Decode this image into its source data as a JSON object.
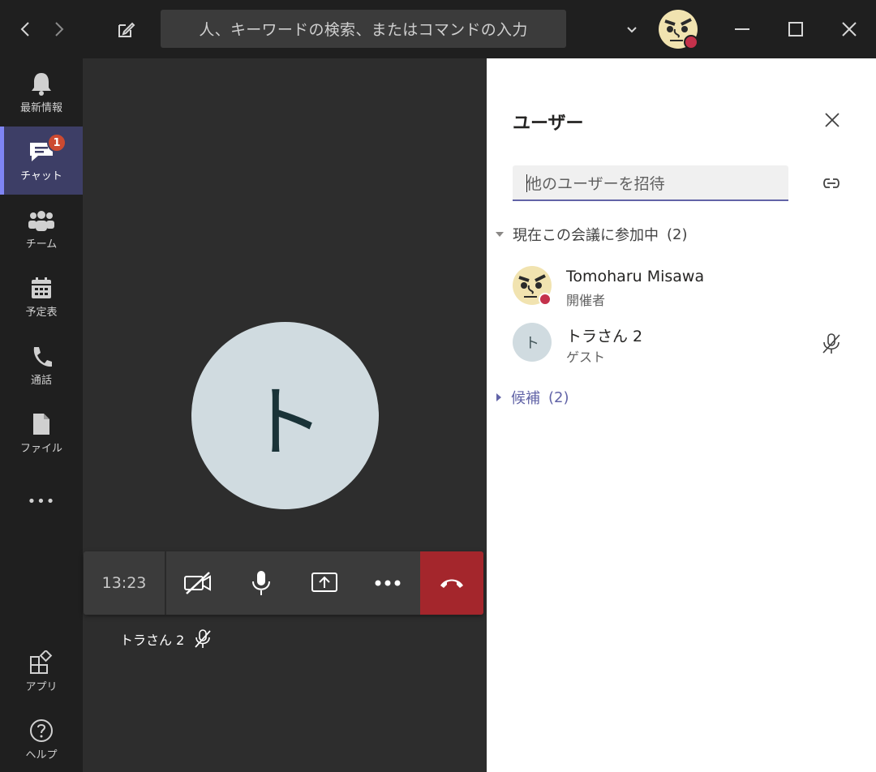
{
  "titlebar": {
    "search_placeholder": "人、キーワードの検索、またはコマンドの入力"
  },
  "rail": {
    "items": [
      {
        "label": "最新情報",
        "icon": "bell-icon"
      },
      {
        "label": "チャット",
        "icon": "chat-icon",
        "badge": "1"
      },
      {
        "label": "チーム",
        "icon": "teams-icon"
      },
      {
        "label": "予定表",
        "icon": "calendar-icon"
      },
      {
        "label": "通話",
        "icon": "phone-icon"
      },
      {
        "label": "ファイル",
        "icon": "file-icon"
      }
    ],
    "more": "•••",
    "bottom": [
      {
        "label": "アプリ",
        "icon": "apps-icon"
      },
      {
        "label": "ヘルプ",
        "icon": "help-icon"
      }
    ]
  },
  "stage": {
    "avatar_initial": "ト",
    "timer": "13:23",
    "participant_name": "トラさん 2"
  },
  "panel": {
    "title": "ユーザー",
    "invite_placeholder": "他のユーザーを招待",
    "current_section": "現在この会議に参加中",
    "current_count": "(2)",
    "participants": [
      {
        "name": "Tomoharu Misawa",
        "role": "開催者"
      },
      {
        "name": "トラさん 2",
        "role": "ゲスト",
        "initial": "ト"
      }
    ],
    "candidates_section": "候補",
    "candidates_count": "(2)"
  },
  "colors": {
    "accent": "#6264a7",
    "hangup": "#a4262c",
    "badge": "#cc4a31",
    "presence_busy": "#c4314b"
  }
}
